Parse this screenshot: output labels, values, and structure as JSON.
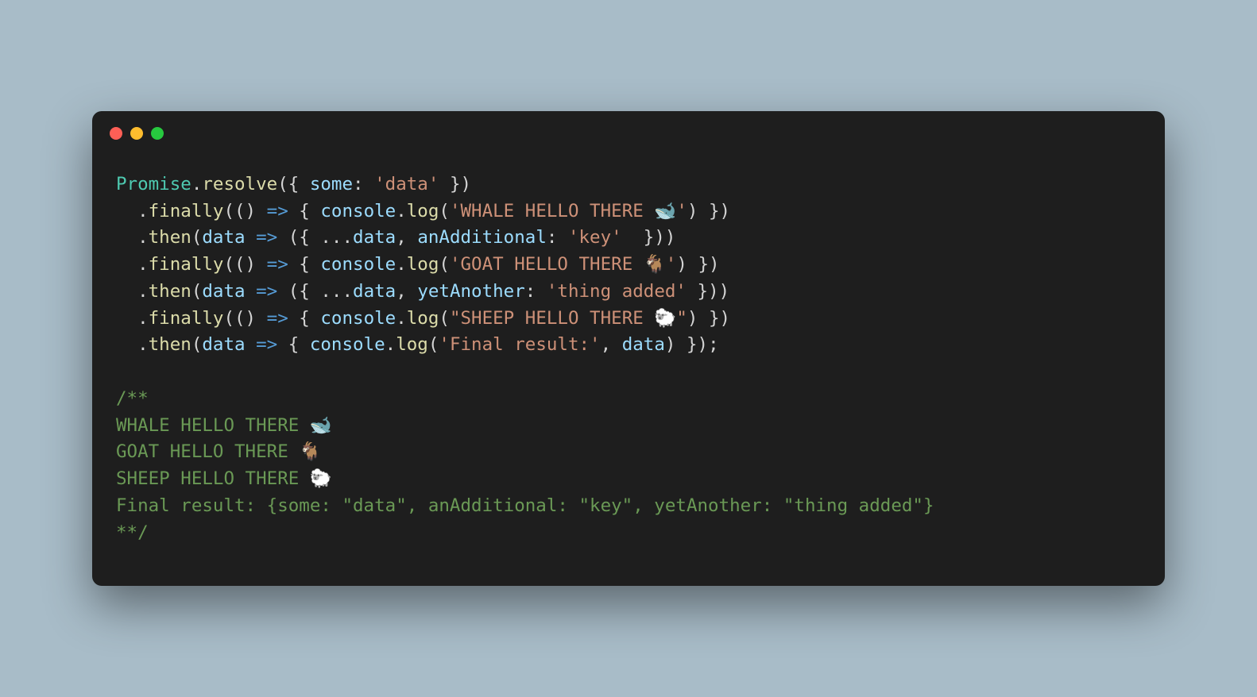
{
  "window": {
    "controls": {
      "red": "red",
      "yellow": "yellow",
      "green": "green"
    }
  },
  "code": {
    "lines": [
      [
        {
          "t": "Promise",
          "c": "tk-class"
        },
        {
          "t": ".",
          "c": "tk-punct"
        },
        {
          "t": "resolve",
          "c": "tk-method"
        },
        {
          "t": "({ ",
          "c": "tk-punct"
        },
        {
          "t": "some",
          "c": "tk-prop"
        },
        {
          "t": ": ",
          "c": "tk-punct"
        },
        {
          "t": "'data'",
          "c": "tk-string"
        },
        {
          "t": " })",
          "c": "tk-punct"
        }
      ],
      [
        {
          "t": "  .",
          "c": "tk-punct"
        },
        {
          "t": "finally",
          "c": "tk-method"
        },
        {
          "t": "(() ",
          "c": "tk-punct"
        },
        {
          "t": "=>",
          "c": "tk-keyword"
        },
        {
          "t": " { ",
          "c": "tk-punct"
        },
        {
          "t": "console",
          "c": "tk-ident"
        },
        {
          "t": ".",
          "c": "tk-punct"
        },
        {
          "t": "log",
          "c": "tk-method"
        },
        {
          "t": "(",
          "c": "tk-punct"
        },
        {
          "t": "'WHALE HELLO THERE 🐋'",
          "c": "tk-string"
        },
        {
          "t": ") })",
          "c": "tk-punct"
        }
      ],
      [
        {
          "t": "  .",
          "c": "tk-punct"
        },
        {
          "t": "then",
          "c": "tk-method"
        },
        {
          "t": "(",
          "c": "tk-punct"
        },
        {
          "t": "data",
          "c": "tk-param"
        },
        {
          "t": " ",
          "c": "tk-punct"
        },
        {
          "t": "=>",
          "c": "tk-keyword"
        },
        {
          "t": " ({ ...",
          "c": "tk-punct"
        },
        {
          "t": "data",
          "c": "tk-ident"
        },
        {
          "t": ", ",
          "c": "tk-punct"
        },
        {
          "t": "anAdditional",
          "c": "tk-prop"
        },
        {
          "t": ": ",
          "c": "tk-punct"
        },
        {
          "t": "'key'",
          "c": "tk-string"
        },
        {
          "t": "  }))",
          "c": "tk-punct"
        }
      ],
      [
        {
          "t": "  .",
          "c": "tk-punct"
        },
        {
          "t": "finally",
          "c": "tk-method"
        },
        {
          "t": "(() ",
          "c": "tk-punct"
        },
        {
          "t": "=>",
          "c": "tk-keyword"
        },
        {
          "t": " { ",
          "c": "tk-punct"
        },
        {
          "t": "console",
          "c": "tk-ident"
        },
        {
          "t": ".",
          "c": "tk-punct"
        },
        {
          "t": "log",
          "c": "tk-method"
        },
        {
          "t": "(",
          "c": "tk-punct"
        },
        {
          "t": "'GOAT HELLO THERE 🐐'",
          "c": "tk-string"
        },
        {
          "t": ") })",
          "c": "tk-punct"
        }
      ],
      [
        {
          "t": "  .",
          "c": "tk-punct"
        },
        {
          "t": "then",
          "c": "tk-method"
        },
        {
          "t": "(",
          "c": "tk-punct"
        },
        {
          "t": "data",
          "c": "tk-param"
        },
        {
          "t": " ",
          "c": "tk-punct"
        },
        {
          "t": "=>",
          "c": "tk-keyword"
        },
        {
          "t": " ({ ...",
          "c": "tk-punct"
        },
        {
          "t": "data",
          "c": "tk-ident"
        },
        {
          "t": ", ",
          "c": "tk-punct"
        },
        {
          "t": "yetAnother",
          "c": "tk-prop"
        },
        {
          "t": ": ",
          "c": "tk-punct"
        },
        {
          "t": "'thing added'",
          "c": "tk-string"
        },
        {
          "t": " }))",
          "c": "tk-punct"
        }
      ],
      [
        {
          "t": "  .",
          "c": "tk-punct"
        },
        {
          "t": "finally",
          "c": "tk-method"
        },
        {
          "t": "(() ",
          "c": "tk-punct"
        },
        {
          "t": "=>",
          "c": "tk-keyword"
        },
        {
          "t": " { ",
          "c": "tk-punct"
        },
        {
          "t": "console",
          "c": "tk-ident"
        },
        {
          "t": ".",
          "c": "tk-punct"
        },
        {
          "t": "log",
          "c": "tk-method"
        },
        {
          "t": "(",
          "c": "tk-punct"
        },
        {
          "t": "\"SHEEP HELLO THERE 🐑\"",
          "c": "tk-string"
        },
        {
          "t": ") })",
          "c": "tk-punct"
        }
      ],
      [
        {
          "t": "  .",
          "c": "tk-punct"
        },
        {
          "t": "then",
          "c": "tk-method"
        },
        {
          "t": "(",
          "c": "tk-punct"
        },
        {
          "t": "data",
          "c": "tk-param"
        },
        {
          "t": " ",
          "c": "tk-punct"
        },
        {
          "t": "=>",
          "c": "tk-keyword"
        },
        {
          "t": " { ",
          "c": "tk-punct"
        },
        {
          "t": "console",
          "c": "tk-ident"
        },
        {
          "t": ".",
          "c": "tk-punct"
        },
        {
          "t": "log",
          "c": "tk-method"
        },
        {
          "t": "(",
          "c": "tk-punct"
        },
        {
          "t": "'Final result:'",
          "c": "tk-string"
        },
        {
          "t": ", ",
          "c": "tk-punct"
        },
        {
          "t": "data",
          "c": "tk-ident"
        },
        {
          "t": ") });",
          "c": "tk-punct"
        }
      ],
      [],
      [
        {
          "t": "/**",
          "c": "tk-comment"
        }
      ],
      [
        {
          "t": "WHALE HELLO THERE 🐋",
          "c": "tk-comment"
        }
      ],
      [
        {
          "t": "GOAT HELLO THERE 🐐",
          "c": "tk-comment"
        }
      ],
      [
        {
          "t": "SHEEP HELLO THERE 🐑",
          "c": "tk-comment"
        }
      ],
      [
        {
          "t": "Final result: {some: \"data\", anAdditional: \"key\", yetAnother: \"thing added\"}",
          "c": "tk-comment"
        }
      ],
      [
        {
          "t": "**/",
          "c": "tk-comment"
        }
      ]
    ]
  }
}
